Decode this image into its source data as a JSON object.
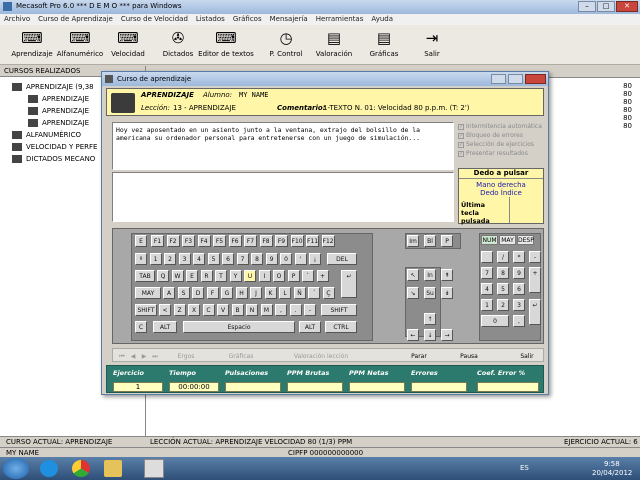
{
  "app": {
    "title": "Mecasoft Pro 6.0 *** D E M O *** para Windows"
  },
  "menu": [
    "Archivo",
    "Curso de Aprendizaje",
    "Curso de Velocidad",
    "Listados",
    "Gráficos",
    "Mensajería",
    "Herramientas",
    "Ayuda"
  ],
  "toolbar": [
    {
      "label": "Aprendizaje",
      "icon": "typewriter-icon"
    },
    {
      "label": "Alfanumérico",
      "icon": "typewriter-icon"
    },
    {
      "label": "Velocidad",
      "icon": "keyboard-icon"
    },
    {
      "label": "Dictados",
      "icon": "cassette-icon"
    },
    {
      "label": "Editor de textos",
      "icon": "typewriter-icon"
    },
    {
      "label": "P. Control",
      "icon": "clock-icon"
    },
    {
      "label": "Valoración",
      "icon": "chart-icon"
    },
    {
      "label": "Gráficas",
      "icon": "chart-icon"
    },
    {
      "label": "Salir",
      "icon": "exit-icon"
    }
  ],
  "sidebar": {
    "header": "CURSOS REALIZADOS",
    "items": [
      "APRENDIZAJE (9,38",
      "APRENDIZAJE",
      "APRENDIZAJE",
      "APRENDIZAJE",
      "ALFANUMÉRICO",
      "VELOCIDAD Y PERFE",
      "DICTADOS MECANO"
    ]
  },
  "bg_numbers": [
    "80",
    "80",
    "80",
    "80",
    "80",
    "80"
  ],
  "dialog": {
    "title": "Curso de aprendizaje",
    "labels": {
      "mode": "APRENDIZAJE",
      "student_label": "Alumno:",
      "student": "MY NAME",
      "lesson_label": "Lección:",
      "lesson": "13 - APRENDIZAJE",
      "comment_label": "Comentario:",
      "comment": "1-TEXTO N. 01: Velocidad 80 p.p.m. (T: 2')"
    },
    "text": "Hoy vez aposentado en un asiento junto a la ventana, extrajo del bolsillo de la americana su ordenador personal para entretenerse con un juego de simulación...",
    "options": [
      "Intermitencia automática",
      "Bloqueo de errores",
      "Selección de ejercicios",
      "Presentar resultados"
    ],
    "finger_title": "Dedo a pulsar",
    "finger_hand": "Mano derecha",
    "finger": "Dedo Índice",
    "last_key_label": "Última tecla pulsada",
    "numpad_status": [
      "NUM",
      "MAY",
      "DESP"
    ],
    "buttons": {
      "ergos": "Ergos",
      "graficas": "Gráficas",
      "valoracion": "Valoración lección",
      "parar": "Parar",
      "pausa": "Pausa",
      "salir": "Salir"
    },
    "stats": {
      "headers": [
        "Ejercicio",
        "Tiempo",
        "Pulsaciones",
        "PPM Brutas",
        "PPM Netas",
        "Errores",
        "Coef. Error %"
      ],
      "values": [
        "1",
        "00:00:00",
        "",
        "",
        "",
        "",
        ""
      ]
    }
  },
  "statusbar": {
    "left": "CURSO ACTUAL: APRENDIZAJE",
    "middle": "LECCIÓN ACTUAL: APRENDIZAJE VELOCIDAD 80 (1/3) PPM",
    "right": "EJERCICIO ACTUAL: 6"
  },
  "statusbar2": {
    "left": "MY NAME",
    "middle": "CIPFP 000000000000"
  },
  "taskbar": {
    "lang": "ES",
    "time": "9:58",
    "date": "20/04/2012"
  },
  "colors": {
    "accent": "#2c7a6e",
    "highlight_key": "#fff6a8",
    "stat_bg": "#ffffc0"
  }
}
